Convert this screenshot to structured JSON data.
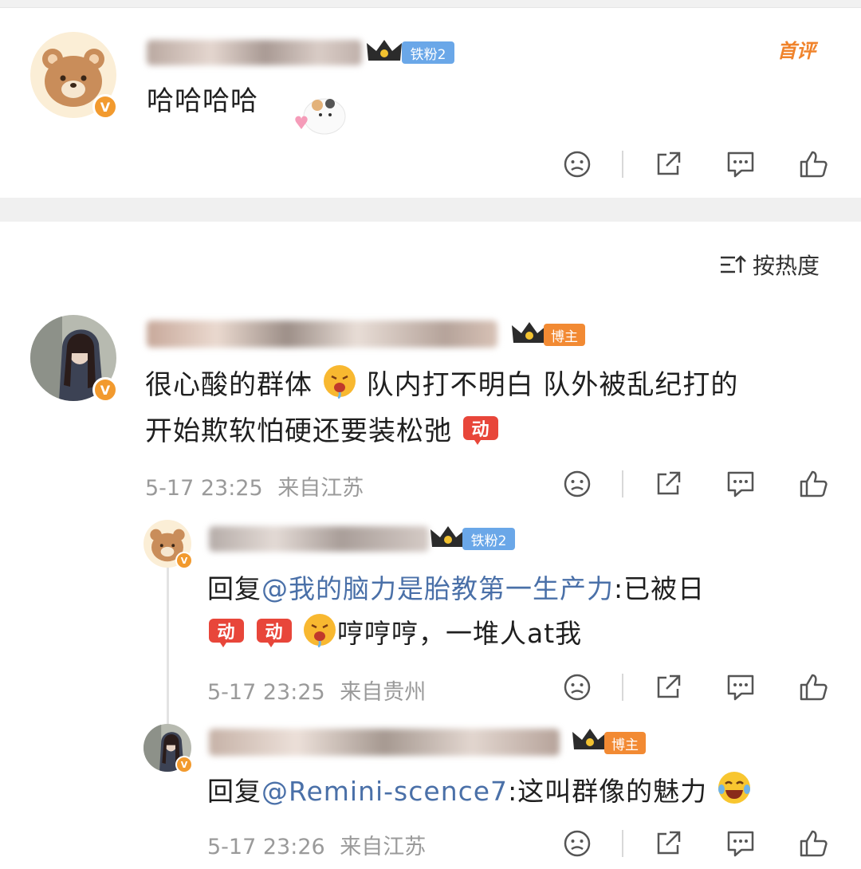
{
  "post_comment": {
    "text": "哈哈哈哈",
    "fan_tag": "铁粉2",
    "first_comment_label": "首评"
  },
  "sort": {
    "label": "按热度",
    "icon": "sort-icon"
  },
  "comment": {
    "line1_a": "很心酸的群体",
    "line1_b": "队内打不明白 队外被乱纪打的",
    "line2": "开始欺软怕硬还要装松弛",
    "tag": "博主",
    "time": "5-17 23:25",
    "location": "来自江苏"
  },
  "reply1": {
    "prefix": "回复",
    "mention": "@我的脑力是胎教第一生产力",
    "text": ":已被日",
    "line2": "哼哼哼，一堆人at我",
    "tag": "铁粉2",
    "time": "5-17 23:25",
    "location": "来自贵州"
  },
  "reply2": {
    "prefix": "回复",
    "mention": "@Remini-scence7",
    "text": ":这叫群像的魅力",
    "tag": "博主",
    "time": "5-17 23:26",
    "location": "来自江苏"
  },
  "sticker_text": "动",
  "actions": [
    "dislike-icon",
    "share-icon",
    "comment-icon",
    "like-icon"
  ],
  "colors": {
    "accent_orange": "#f28a33",
    "fan_blue": "#6aa7e8",
    "mention_blue": "#4a70a8",
    "meta_gray": "#9a9a9a"
  }
}
